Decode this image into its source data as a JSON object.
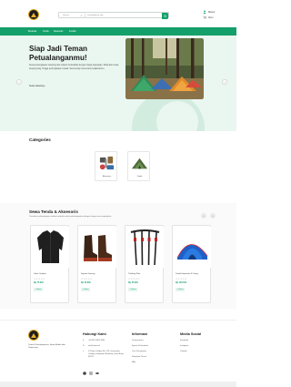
{
  "header": {
    "search_category": "Semua",
    "search_placeholder": "cari produk di sini...",
    "account_label": "Masuk",
    "cart_label": "Akun"
  },
  "nav": {
    "items": [
      "Beranda",
      "Tenda",
      "Aksesoris",
      "Kontak"
    ]
  },
  "hero": {
    "title_line1": "Siap Jadi Teman",
    "title_line2": "Petualanganmu!",
    "description": "Sewa perlengkapan camping dan outdoor berkualitas dengan harga terjangkau. Mulai dari tenda, sleeping bag, hingga perlengkapan masak. Semua siap menemani perjalananmu.",
    "cta": "Sewa sekarang ›"
  },
  "categories": {
    "title": "Categories",
    "items": [
      {
        "label": "Aksesoris",
        "icon": "accessories-icon"
      },
      {
        "label": "Tenda",
        "icon": "tent-icon"
      }
    ]
  },
  "products": {
    "title": "Sewa Tenda & Aksesoris",
    "subtitle": "Temukan perlengkapan outdoor terbaik untuk petualanganmu dengan harga sewa terjangkau.",
    "items": [
      {
        "name": "Jaket Outdoor",
        "price": "Rp 75.000",
        "button": "+ Sewa"
      },
      {
        "name": "Sepatu Gunung",
        "price": "Rp 50.000",
        "button": "+ Sewa"
      },
      {
        "name": "Trekking Pole",
        "price": "Rp 25.000",
        "button": "+ Sewa"
      },
      {
        "name": "Tenda Kapasitas 4 Orang",
        "price": "Rp 100.000",
        "button": "+ Sewa"
      }
    ]
  },
  "footer": {
    "tagline": "Teman Petualanganmu, Sewa Mudah dan Terpercaya",
    "contact": {
      "title": "Hubungi Kami",
      "phone": "+62 812-3456-7890",
      "email": "info@sewa.id",
      "address": "Jl. Raya Ciwidey No. 123, Kecamatan Ciwidey, Kabupaten Bandung, Jawa Barat 40973"
    },
    "info": {
      "title": "Informasi",
      "links": [
        "Tentang Kami",
        "Syarat & Ketentuan",
        "Cara Penyewaan",
        "Kebijakan Privasi",
        "FAQ"
      ]
    },
    "social": {
      "title": "Media Sosial",
      "links": [
        "Facebook",
        "Instagram",
        "Youtube"
      ]
    }
  },
  "colors": {
    "primary": "#14a06a",
    "hero_bg": "#eaf6f0"
  }
}
